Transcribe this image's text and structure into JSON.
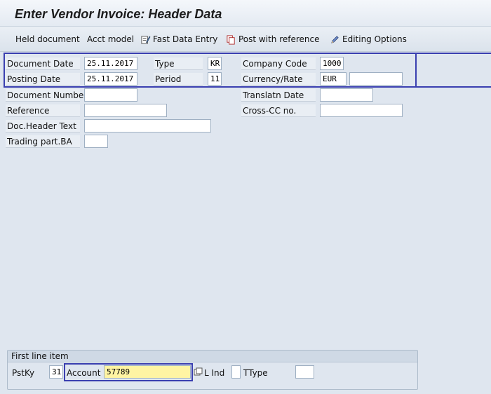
{
  "title": "Enter Vendor Invoice: Header Data",
  "toolbar": {
    "held_document": "Held document",
    "acct_model": "Acct model",
    "fast_data_entry": "Fast Data Entry",
    "post_with_reference": "Post with reference",
    "editing_options": "Editing Options"
  },
  "header": {
    "document_date_label": "Document Date",
    "document_date": "25.11.2017",
    "type_label": "Type",
    "type": "KR",
    "company_code_label": "Company Code",
    "company_code": "1000",
    "posting_date_label": "Posting Date",
    "posting_date": "25.11.2017",
    "period_label": "Period",
    "period": "11",
    "currency_rate_label": "Currency/Rate",
    "currency": "EUR",
    "rate": "",
    "document_number_label": "Document Number",
    "document_number": "",
    "translatn_date_label": "Translatn Date",
    "translatn_date": "",
    "reference_label": "Reference",
    "reference": "",
    "cross_cc_label": "Cross-CC no.",
    "cross_cc": "",
    "doc_header_text_label": "Doc.Header Text",
    "doc_header_text": "",
    "trading_part_label": "Trading part.BA",
    "trading_part": ""
  },
  "first_line_item": {
    "group_title": "First line item",
    "pstky_label": "PstKy",
    "pstky": "31",
    "account_label": "Account",
    "account": "57789",
    "l_ind_label": "L Ind",
    "l_ind": "",
    "ttype_label": "TType",
    "ttype": ""
  },
  "colors": {
    "highlight": "#3a3fb0",
    "active_field": "#fff4a3"
  }
}
